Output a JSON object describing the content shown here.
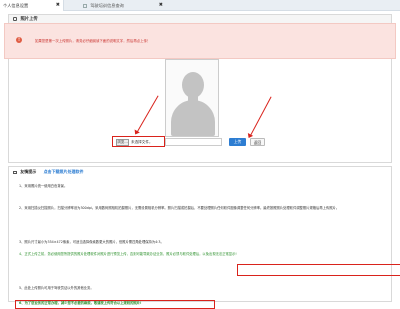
{
  "tabs": [
    {
      "label": "个人信息设置",
      "active": true
    },
    {
      "label": "驾驶培训信息查询",
      "active": false
    }
  ],
  "upload_panel": {
    "title": "照片上传",
    "alert": "如果您是第一次上传照片，请务必仔细阅读下面的说明文字，然后再点上传！",
    "browse_label": "浏览...",
    "file_status": "未选择文件。",
    "upload_label": "上传",
    "back_label": "返回"
  },
  "tips_panel": {
    "tab_active": "友情提示",
    "tab_link": "点击下载照片处理软件",
    "items": [
      {
        "num": "1、",
        "text": "采用照片统一使用白色背景。"
      },
      {
        "num": "2、",
        "text": "采用扫描仪扫描照片，扫描分辨率设为300dpi。采用数码照相机拍摄照片，无需设置相机分辨率。照片扫描或拍摄后，不要处理照片任何软件图像调整任何分辨率。最终按照照片处理软件调整照片规格后再上传照片。"
      },
      {
        "num": "3、",
        "text": "照片尺寸最小为354×472像素，可适当选择像素数更大的照片，但照片需四角处理保持为4:3。"
      },
      {
        "num": "4、",
        "text": "正式上传之前，务必使用您所提供的照片处理软件对照片进行预览上传，否则可能导致办证业务，照片必须与软件处理后，以免出现无法正常显示!"
      },
      {
        "num": "5、",
        "text": "此处上传照片可用于驾驶员证以外的其他业务。"
      },
      {
        "num": "6、",
        "text": "为了您业务的正常办理，减少您不必要的麻烦，敬请按上传符合以上规则的照片!"
      }
    ]
  },
  "colors": {
    "accent": "#2d7dd2",
    "highlight": "#d9231c",
    "alert_bg": "#fbe3e0"
  }
}
